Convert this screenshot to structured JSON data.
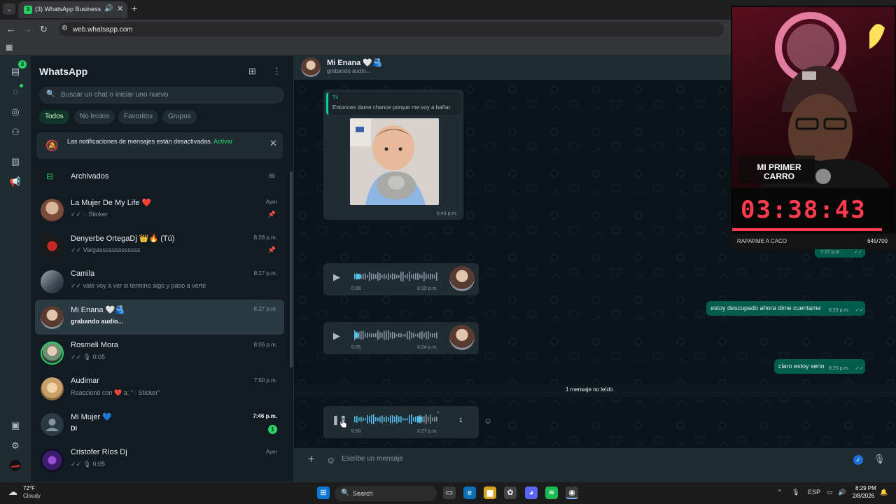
{
  "browser": {
    "tab_title": "(3) WhatsApp Business",
    "tab_badge": "3",
    "url": "web.whatsapp.com"
  },
  "rail": {
    "chats_badge": "3"
  },
  "sidebar": {
    "title": "WhatsApp",
    "search_placeholder": "Buscar un chat o iniciar uno nuevo",
    "filters": [
      "Todos",
      "No leídos",
      "Favoritos",
      "Grupos"
    ],
    "notification": {
      "text": "Las notificaciones de mensajes están desactivadas.",
      "action": "Activar"
    },
    "archived": {
      "label": "Archivados",
      "count": "89"
    },
    "chats": [
      {
        "name": "La Mujer De My Life ❤️",
        "time": "Ayer",
        "preview": "✓✓ ◌ Sticker",
        "pinned": true
      },
      {
        "name": "Denyerbe OrtegaDj 👑🔥 (Tú)",
        "time": "8:28 p.m.",
        "preview": "✓✓ Vargasssssssssssss",
        "pinned": true
      },
      {
        "name": "Camila",
        "time": "8:27 p.m.",
        "preview": "✓✓ vale voy a ver si termino algo y paso a verte"
      },
      {
        "name": "Mi Enana 🤍🫂",
        "time": "8:27 p.m.",
        "preview": "grabando audio...",
        "selected": true
      },
      {
        "name": "Rosmeli Mora",
        "time": "8:06 p.m.",
        "preview": "✓✓ 🎙 0:05"
      },
      {
        "name": "Audimar",
        "time": "7:50 p.m.",
        "preview": "Reaccionó con ❤️ a: \"◌ Sticker\""
      },
      {
        "name": "Mi Mujer 💙",
        "time": "7:46 p.m.",
        "preview": "Dl",
        "unread": "1"
      },
      {
        "name": "Cristofer Ríos Dj",
        "time": "Ayer",
        "preview": "✓✓ 🎙 0:05"
      }
    ]
  },
  "conversation": {
    "name": "Mi Enana 🤍🫂",
    "status": "grabando audio...",
    "quoted_author": "Tú",
    "quoted_text": "Entonces dame chance porque me voy a bañar",
    "image_time": "6:49 p.m.",
    "voice_notes": [
      {
        "duration": "0:08",
        "time": "8:19 p.m."
      },
      {
        "duration": "0:05",
        "time": "8:24 p.m."
      },
      {
        "duration": "0:50",
        "time": "8:27 p.m.",
        "playing": true,
        "speed": "1"
      }
    ],
    "outgoing": [
      {
        "text": "",
        "time": "7:27 p.m."
      },
      {
        "text": "estoy descupado ahora dime cuentame",
        "time": "8:23 p.m."
      },
      {
        "text": "claro estoy serio",
        "time": "8:25 p.m."
      }
    ],
    "unread_separator": "1 mensaje no leído",
    "composer_placeholder": "Escribe un mensaje"
  },
  "overlay": {
    "sign_text": "MI PRIMER CARRO",
    "timer": "03:38:43",
    "goal_label": "RAPARME A CACO",
    "goal_count": "645/700",
    "goal_progress": 0.921
  },
  "taskbar": {
    "temperature": "72°F",
    "condition": "Cloudy",
    "search": "Search",
    "language": "ESP",
    "time": "8:29 PM",
    "date": "2/8/2026"
  },
  "colors": {
    "accent": "#25d366",
    "outgoing_bubble": "#005c4b",
    "incoming_bubble": "#202c33",
    "timer": "#ff3b4e"
  }
}
